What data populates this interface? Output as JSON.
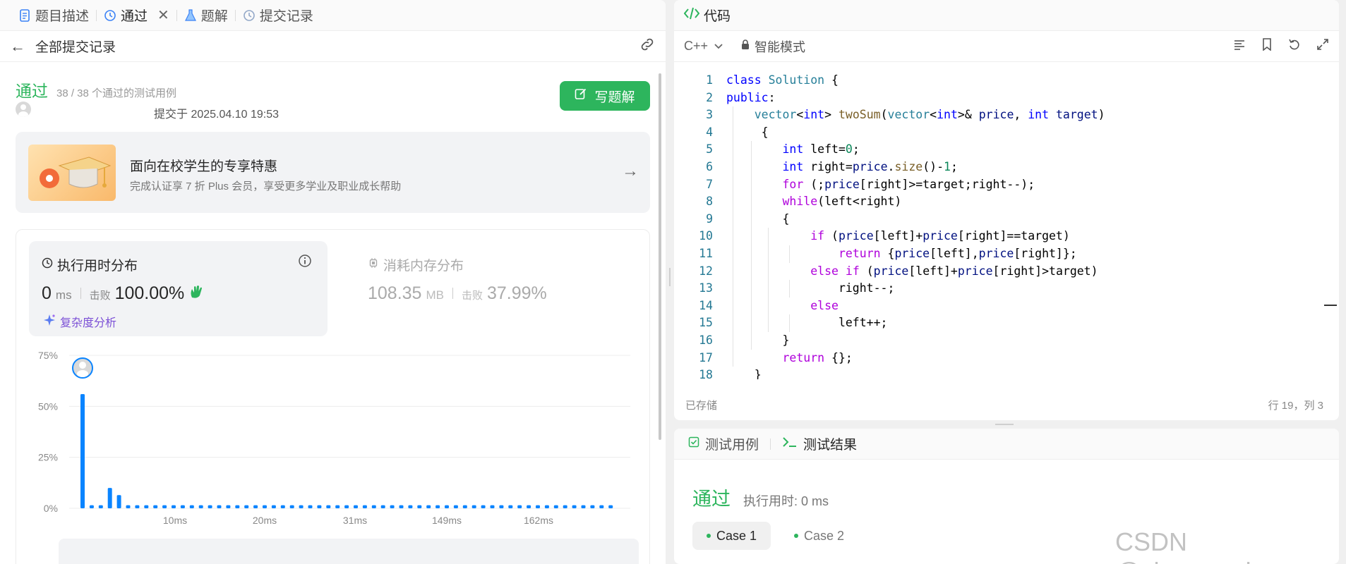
{
  "left": {
    "tabs": [
      {
        "label": "题目描述"
      },
      {
        "label": "通过"
      },
      {
        "label": "题解"
      },
      {
        "label": "提交记录"
      }
    ],
    "back_label": "全部提交记录",
    "status": "通过",
    "status_count": "38 / 38 个通过的测试用例",
    "submit_time": "提交于 2025.04.10 19:53",
    "write_solution": "写题解",
    "promo": {
      "title": "面向在校学生的专享特惠",
      "subtitle": "完成认证享 7 折 Plus 会员，享受更多学业及职业成长帮助"
    },
    "runtime": {
      "title": "执行用时分布",
      "value": "0",
      "unit": "ms",
      "beat_label": "击败",
      "beat": "100.00%",
      "complexity": "复杂度分析"
    },
    "memory": {
      "title": "消耗内存分布",
      "value": "108.35",
      "unit": "MB",
      "beat_label": "击败",
      "beat": "37.99%"
    }
  },
  "chart_data": {
    "type": "bar",
    "y_ticks": [
      "75%",
      "50%",
      "25%",
      "0%"
    ],
    "ylim": [
      0,
      75
    ],
    "x_tick_labels": [
      "10ms",
      "20ms",
      "31ms",
      "149ms",
      "162ms"
    ],
    "values": [
      56,
      1.5,
      1.5,
      10,
      6.5,
      1.5,
      1.5,
      1.5,
      1.5,
      1.5,
      1.5,
      1.5,
      1.5,
      1.5,
      1.5,
      1.5,
      1.5,
      1.5,
      1.5,
      1.5,
      1.5,
      1.5,
      1.5,
      1.5,
      1.5,
      1.5,
      1.5,
      1.5,
      1.5,
      1.5,
      1.5,
      1.5,
      1.5,
      1.5,
      1.5,
      1.5,
      1.5,
      1.5,
      1.5,
      1.5,
      1.5,
      1.5,
      1.5,
      1.5,
      1.5,
      1.5,
      1.5,
      1.5,
      1.5,
      1.5,
      1.5,
      1.5,
      1.5,
      1.5,
      1.5,
      1.5,
      1.5,
      1.5,
      1.5
    ],
    "bar_color": "#0a84ff",
    "grid": true
  },
  "code_panel": {
    "title": "代码",
    "language": "C++",
    "mode": "智能模式",
    "saved": "已存储",
    "cursor": "行 19，列 3",
    "lines": [
      [
        [
          "kw",
          "class"
        ],
        [
          "",
          " "
        ],
        [
          "ty",
          "Solution"
        ],
        [
          "",
          " {"
        ]
      ],
      [
        [
          "kw",
          "public"
        ],
        [
          "",
          ":"
        ]
      ],
      [
        [
          "",
          "    "
        ],
        [
          "ty",
          "vector"
        ],
        [
          "",
          "<"
        ],
        [
          "kw",
          "int"
        ],
        [
          "",
          "> "
        ],
        [
          "fn",
          "twoSum"
        ],
        [
          "",
          "("
        ],
        [
          "ty",
          "vector"
        ],
        [
          "",
          "<"
        ],
        [
          "kw",
          "int"
        ],
        [
          "",
          ">& "
        ],
        [
          "vr",
          "price"
        ],
        [
          "",
          ", "
        ],
        [
          "kw",
          "int"
        ],
        [
          "",
          " "
        ],
        [
          "vr",
          "target"
        ],
        [
          "",
          ")"
        ]
      ],
      [
        [
          "",
          "     {"
        ]
      ],
      [
        [
          "",
          "        "
        ],
        [
          "kw",
          "int"
        ],
        [
          "",
          " left="
        ],
        [
          "nm",
          "0"
        ],
        [
          "",
          ";"
        ]
      ],
      [
        [
          "",
          "        "
        ],
        [
          "kw",
          "int"
        ],
        [
          "",
          " right="
        ],
        [
          "vr",
          "price"
        ],
        [
          "",
          "."
        ],
        [
          "fn",
          "size"
        ],
        [
          "",
          "()-"
        ],
        [
          "nm",
          "1"
        ],
        [
          "",
          ";"
        ]
      ],
      [
        [
          "",
          "        "
        ],
        [
          "ctl",
          "for"
        ],
        [
          "",
          " (;"
        ],
        [
          "vr",
          "price"
        ],
        [
          "",
          "[right]>=target;right--);"
        ]
      ],
      [
        [
          "",
          "        "
        ],
        [
          "ctl",
          "while"
        ],
        [
          "",
          "(left<right)"
        ]
      ],
      [
        [
          "",
          "        {"
        ]
      ],
      [
        [
          "",
          "            "
        ],
        [
          "ctl",
          "if"
        ],
        [
          "",
          " ("
        ],
        [
          "vr",
          "price"
        ],
        [
          "",
          "[left]+"
        ],
        [
          "vr",
          "price"
        ],
        [
          "",
          "[right]==target)"
        ]
      ],
      [
        [
          "",
          "                "
        ],
        [
          "ctl",
          "return"
        ],
        [
          "",
          " {"
        ],
        [
          "vr",
          "price"
        ],
        [
          "",
          "[left],"
        ],
        [
          "vr",
          "price"
        ],
        [
          "",
          "[right]};"
        ]
      ],
      [
        [
          "",
          "            "
        ],
        [
          "ctl",
          "else"
        ],
        [
          "",
          " "
        ],
        [
          "ctl",
          "if"
        ],
        [
          "",
          " ("
        ],
        [
          "vr",
          "price"
        ],
        [
          "",
          "[left]+"
        ],
        [
          "vr",
          "price"
        ],
        [
          "",
          "[right]>target)"
        ]
      ],
      [
        [
          "",
          "                right--;"
        ]
      ],
      [
        [
          "",
          "            "
        ],
        [
          "ctl",
          "else"
        ]
      ],
      [
        [
          "",
          "                left++;"
        ]
      ],
      [
        [
          "",
          "        }"
        ]
      ],
      [
        [
          "",
          "        "
        ],
        [
          "ctl",
          "return"
        ],
        [
          "",
          " {};"
        ]
      ],
      [
        [
          "",
          "    }"
        ]
      ]
    ]
  },
  "test_panel": {
    "tabs": [
      {
        "label": "测试用例"
      },
      {
        "label": "测试结果"
      }
    ],
    "result": "通过",
    "runtime": "执行用时: 0 ms",
    "cases": [
      {
        "label": "Case 1"
      },
      {
        "label": "Case 2"
      }
    ]
  },
  "watermark": "CSDN @zhangcoder"
}
